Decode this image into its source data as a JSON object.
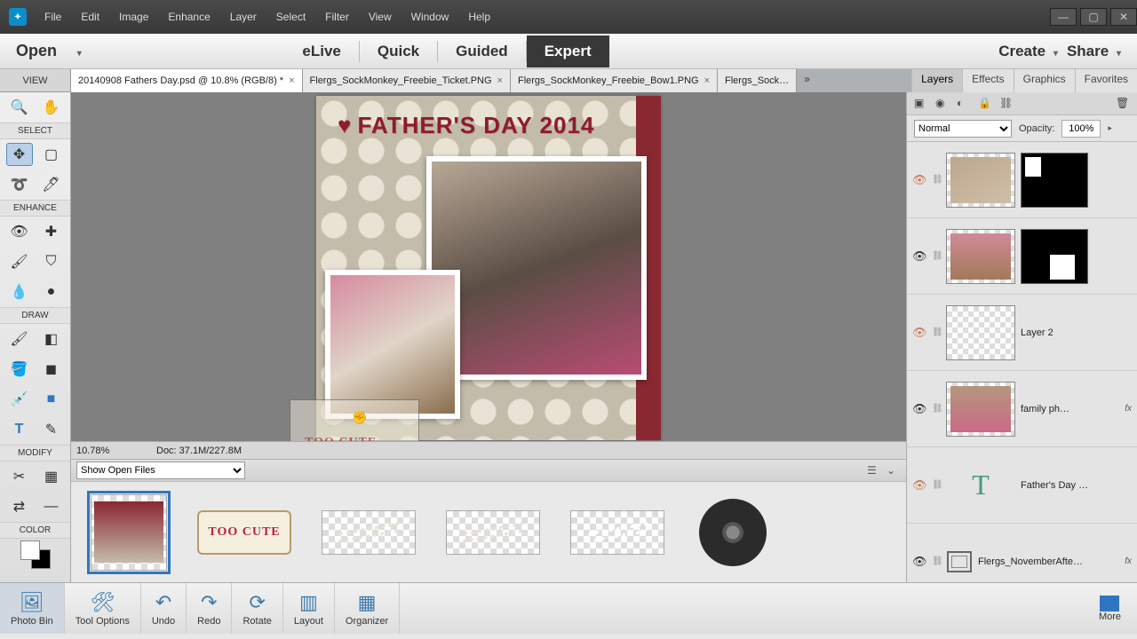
{
  "menu": [
    "File",
    "Edit",
    "Image",
    "Enhance",
    "Layer",
    "Select",
    "Filter",
    "View",
    "Window",
    "Help"
  ],
  "open_label": "Open",
  "modes": {
    "elive": "eLive",
    "quick": "Quick",
    "guided": "Guided",
    "expert": "Expert"
  },
  "create": "Create",
  "share": "Share",
  "view_label": "VIEW",
  "doc_tabs": [
    "20140908 Fathers Day.psd @ 10.8% (RGB/8) *",
    "Flergs_SockMonkey_Freebie_Ticket.PNG",
    "Flergs_SockMonkey_Freebie_Bow1.PNG",
    "Flergs_Sock…"
  ],
  "panel_tabs": [
    "Layers",
    "Effects",
    "Graphics",
    "Favorites"
  ],
  "toolbox": {
    "select": "SELECT",
    "enhance": "ENHANCE",
    "draw": "DRAW",
    "modify": "MODIFY",
    "color": "COLOR"
  },
  "scrapbook_title": "FATHER'S DAY 2014",
  "ghost_label": "TOO CUTE",
  "status": {
    "zoom": "10.78%",
    "doc": "Doc: 37.1M/227.8M"
  },
  "bin_dropdown": "Show Open Files",
  "too_cute": "TOO CUTE",
  "blend_mode": "Normal",
  "opacity_label": "Opacity:",
  "opacity_value": "100%",
  "layers": [
    {
      "visible": false,
      "name": "",
      "mask": "tl"
    },
    {
      "visible": true,
      "name": "",
      "mask": "br"
    },
    {
      "visible": false,
      "name": "Layer 2",
      "mask": null,
      "checker": true
    },
    {
      "visible": true,
      "name": "family ph…",
      "mask": null,
      "fx": true
    },
    {
      "visible": false,
      "name": "Father's Day …",
      "type": true
    },
    {
      "visible": true,
      "name": "Flergs_NovemberAfte…",
      "smart": true,
      "fx": true
    }
  ],
  "bottombar": [
    "Photo Bin",
    "Tool Options",
    "Undo",
    "Redo",
    "Rotate",
    "Layout",
    "Organizer"
  ],
  "more": "More"
}
